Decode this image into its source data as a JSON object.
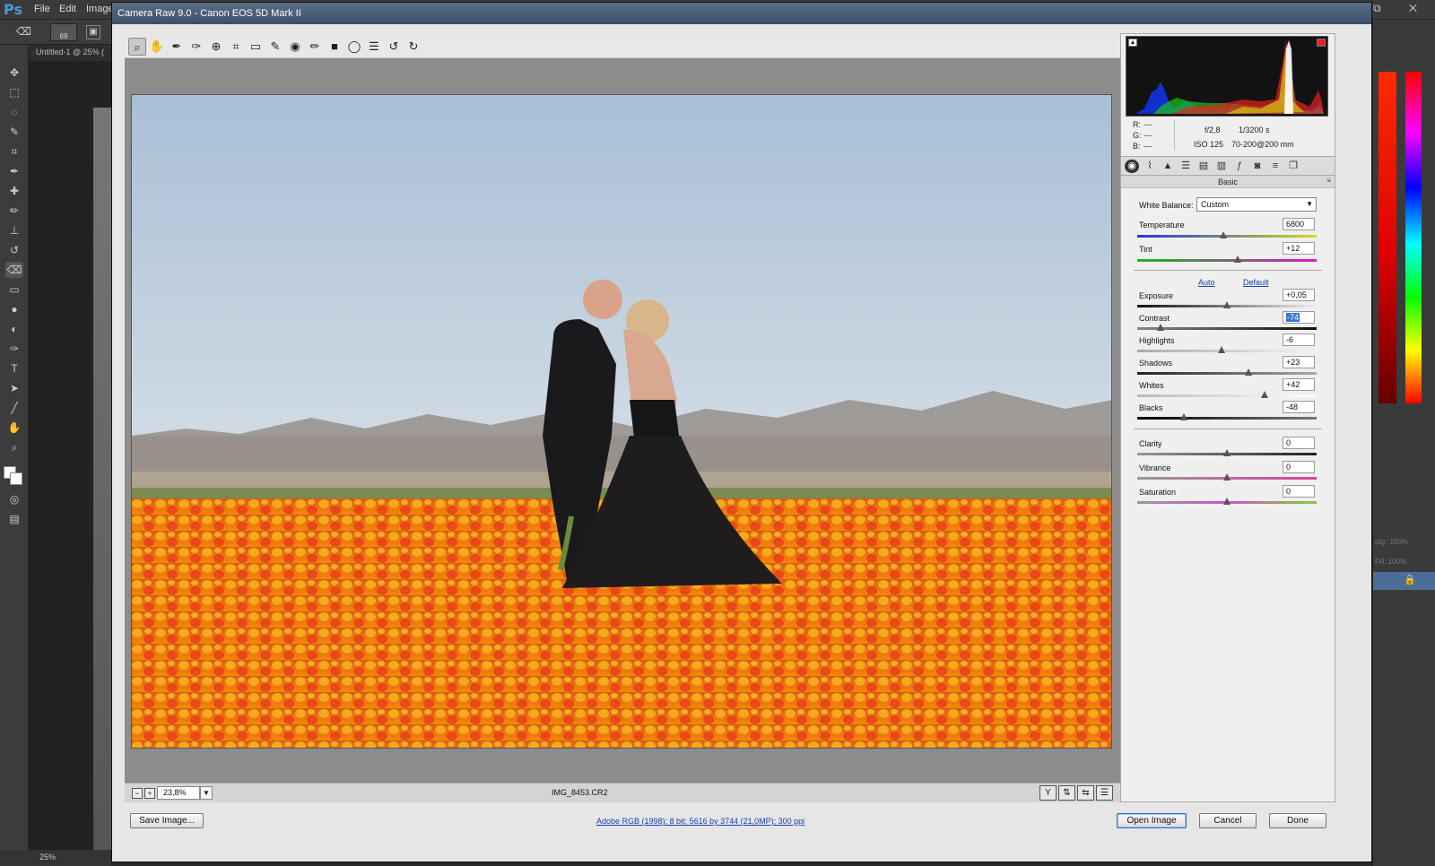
{
  "photoshop": {
    "logo": "Ps",
    "menus": [
      "File",
      "Edit",
      "Image"
    ],
    "brush_size": "69",
    "doc_tab": "Untitled-1 @ 25% (",
    "zoom_status": "25%",
    "window_controls": "⧉ ✕",
    "right_panel_faint": {
      "opacity": "city: 100%",
      "fill": "Fill: 100%"
    }
  },
  "dialog": {
    "title": "Camera Raw 9.0  -  Canon EOS 5D Mark II",
    "toolbar_icons": [
      "zoom-tool",
      "hand-tool",
      "white-balance-tool",
      "color-sampler-tool",
      "targeted-adjustment-tool",
      "crop-tool",
      "straighten-tool",
      "spot-removal-tool",
      "red-eye-tool",
      "adjustment-brush-tool",
      "graduated-filter-tool",
      "radial-filter-tool",
      "preferences",
      "rotate-ccw",
      "rotate-cw"
    ]
  },
  "histogram": {
    "rgb": {
      "r_label": "R:",
      "r": "---",
      "g_label": "G:",
      "g": "---",
      "b_label": "B:",
      "b": "---"
    },
    "exif": {
      "aperture": "f/2,8",
      "shutter": "1/3200 s",
      "iso": "ISO 125",
      "lens": "70-200@200 mm"
    }
  },
  "panel_tabs": [
    "Basic",
    "Tone Curve",
    "Detail",
    "HSL / Grayscale",
    "Split Toning",
    "Lens Corrections",
    "Effects",
    "Camera Calibration",
    "Presets",
    "Snapshots"
  ],
  "basic": {
    "section_title": "Basic",
    "white_balance_label": "White Balance:",
    "white_balance_value": "Custom",
    "auto_label": "Auto",
    "default_label": "Default",
    "sliders": [
      {
        "label": "Temperature",
        "value": "6800",
        "pos": 0.48
      },
      {
        "label": "Tint",
        "value": "+12",
        "pos": 0.56
      },
      {
        "label": "Exposure",
        "value": "+0,05",
        "pos": 0.5
      },
      {
        "label": "Contrast",
        "value": "-74",
        "pos": 0.13
      },
      {
        "label": "Highlights",
        "value": "-6",
        "pos": 0.47
      },
      {
        "label": "Shadows",
        "value": "+23",
        "pos": 0.62
      },
      {
        "label": "Whites",
        "value": "+42",
        "pos": 0.71
      },
      {
        "label": "Blacks",
        "value": "-48",
        "pos": 0.26
      },
      {
        "label": "Clarity",
        "value": "0",
        "pos": 0.5
      },
      {
        "label": "Vibrance",
        "value": "0",
        "pos": 0.5
      },
      {
        "label": "Saturation",
        "value": "0",
        "pos": 0.5
      }
    ]
  },
  "preview": {
    "zoom": "23,8%",
    "filename": "IMG_8453.CR2"
  },
  "footer": {
    "save_label": "Save Image...",
    "workflow": "Adobe RGB (1998); 8 bit; 5616 by 3744 (21,0MP); 300 ppi",
    "open_label": "Open Image",
    "cancel_label": "Cancel",
    "done_label": "Done"
  }
}
